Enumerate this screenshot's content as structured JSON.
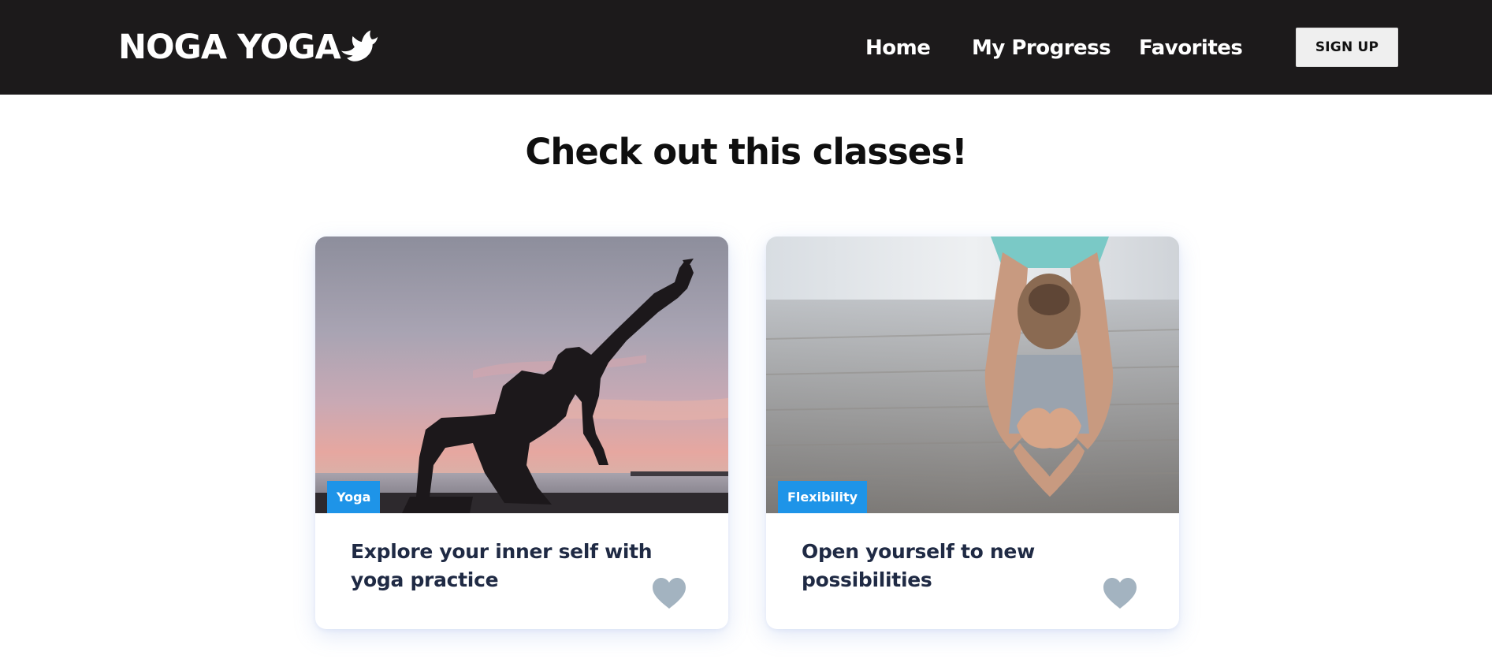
{
  "header": {
    "brand": "NOGA YOGA",
    "brand_icon": "dove-icon",
    "nav": {
      "home": "Home",
      "progress": "My Progress",
      "favorites": "Favorites"
    },
    "signup_label": "SIGN UP"
  },
  "main": {
    "title": "Check out this classes!",
    "cards": [
      {
        "category": "Yoga",
        "title": "Explore your inner self with yoga practice",
        "image": "sunset-yoga-silhouette",
        "favorite_icon": "heart-icon"
      },
      {
        "category": "Flexibility",
        "title": "Open yourself to new possibilities",
        "image": "seated-forward-bend",
        "favorite_icon": "heart-icon"
      }
    ]
  },
  "colors": {
    "navbar_bg": "#1c1a1b",
    "tag_bg": "#1e94e8",
    "card_title": "#1f2a44",
    "heart": "#a3b3c0"
  }
}
